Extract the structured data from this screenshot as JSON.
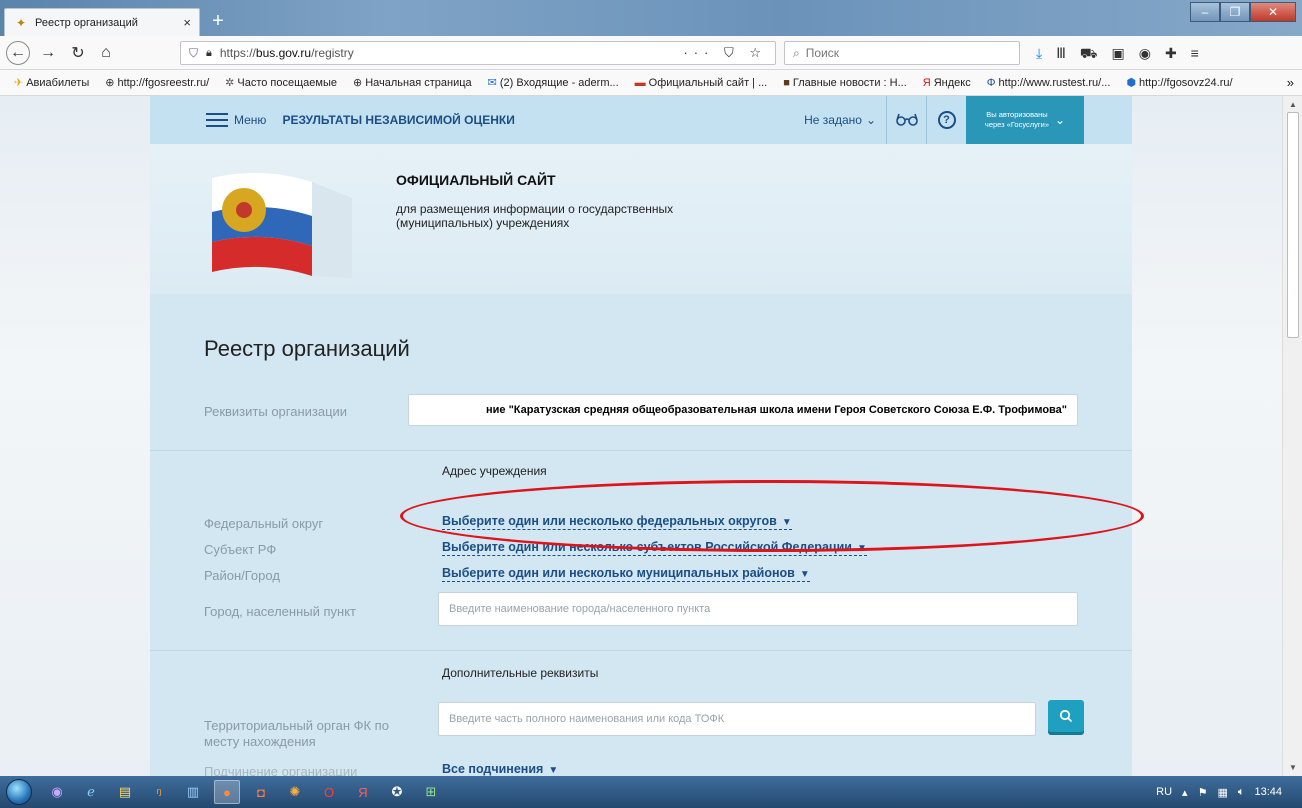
{
  "browser": {
    "tab_title": "Реестр организаций",
    "tab_close": "×",
    "new_tab": "+",
    "url_prefix": "https://",
    "url_domain": "bus.gov.ru",
    "url_path": "/registry",
    "search_placeholder": "Поиск",
    "url_actions": "··· ⛉ ☆"
  },
  "bookmarks": [
    {
      "icon": "plane-icon",
      "label": "Авиабилеты"
    },
    {
      "icon": "globe-icon",
      "label": "http://fgosreestr.ru/"
    },
    {
      "icon": "gear-icon",
      "label": "Часто посещаемые"
    },
    {
      "icon": "globe-icon",
      "label": "Начальная страница"
    },
    {
      "icon": "mail-icon",
      "label": "(2) Входящие - aderm..."
    },
    {
      "icon": "site-icon",
      "label": "Официальный сайт | ..."
    },
    {
      "icon": "news-icon",
      "label": "Главные новости : Н..."
    },
    {
      "icon": "yandex-icon",
      "label": "Яндекс"
    },
    {
      "icon": "rustest-icon",
      "label": "http://www.rustest.ru/..."
    },
    {
      "icon": "fgos-icon",
      "label": "http://fgosovz24.ru/"
    }
  ],
  "site_header": {
    "menu_label": "Меню",
    "section_title": "РЕЗУЛЬТАТЫ НЕЗАВИСИМОЙ ОЦЕНКИ",
    "region_select": "Не задано",
    "help_symbol": "?",
    "auth_line1": "Вы авторизованы",
    "auth_line2": "через «Госуслуги»"
  },
  "hero": {
    "title": "ОФИЦИАЛЬНЫЙ САЙТ",
    "subtitle_line1": "для размещения информации о государственных",
    "subtitle_line2": "(муниципальных) учреждениях"
  },
  "registry": {
    "title": "Реестр организаций",
    "requisites_label": "Реквизиты организации",
    "requisites_value": "ние \"Каратузская средняя общеобразовательная школа имени Героя Советского Союза Е.Ф. Трофимова\"",
    "address_group": "Адрес учреждения",
    "federal_district_label": "Федеральный округ",
    "federal_district_select": "Выберите один или несколько федеральных округов",
    "subject_label": "Субъект РФ",
    "subject_select": "Выберите один или несколько субъектов Российской Федерации",
    "district_label": "Район/Город",
    "district_select": "Выберите один или несколько муниципальных районов",
    "city_label": "Город, населенный пункт",
    "city_placeholder": "Введите наименование города/населенного пункта",
    "extra_group": "Дополнительные реквизиты",
    "tofk_label_line1": "Территориальный орган ФК по",
    "tofk_label_line2": "месту нахождения",
    "tofk_placeholder": "Введите часть полного наименования или кода ТОФК",
    "subordination_label": "Подчинение организации",
    "subordination_select": "Все подчинения"
  },
  "taskbar": {
    "lang": "RU",
    "time": "13:44"
  },
  "colors": {
    "header_bg": "#c3e1f0",
    "link_blue": "#1b4e87",
    "auth_btn": "#2a97b8",
    "highlight_red": "#e0121a"
  }
}
